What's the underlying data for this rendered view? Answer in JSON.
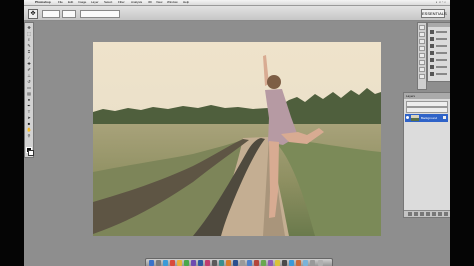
{
  "app": {
    "name": "Photoshop",
    "menus": [
      "File",
      "Edit",
      "Image",
      "Layer",
      "Select",
      "Filter",
      "Analysis",
      "3D",
      "View",
      "Window",
      "Help"
    ]
  },
  "options_bar": {
    "workspace_label": "ESSENTIALS"
  },
  "layers_panel": {
    "tabs": "Layers",
    "layer_name": "Background"
  },
  "toolbox": {
    "tools": [
      "move",
      "marquee",
      "lasso",
      "quick-select",
      "crop",
      "eyedropper",
      "healing",
      "brush",
      "clone-stamp",
      "history-brush",
      "eraser",
      "gradient",
      "dodge",
      "pen",
      "type",
      "path-select",
      "shape",
      "hand",
      "zoom"
    ]
  },
  "photo": {
    "subject": "girl dancing on dirt road"
  },
  "colors": {
    "interface_grey": "#8e8e8e",
    "selected_layer": "#2f63c8",
    "letterbox": "#050505"
  }
}
